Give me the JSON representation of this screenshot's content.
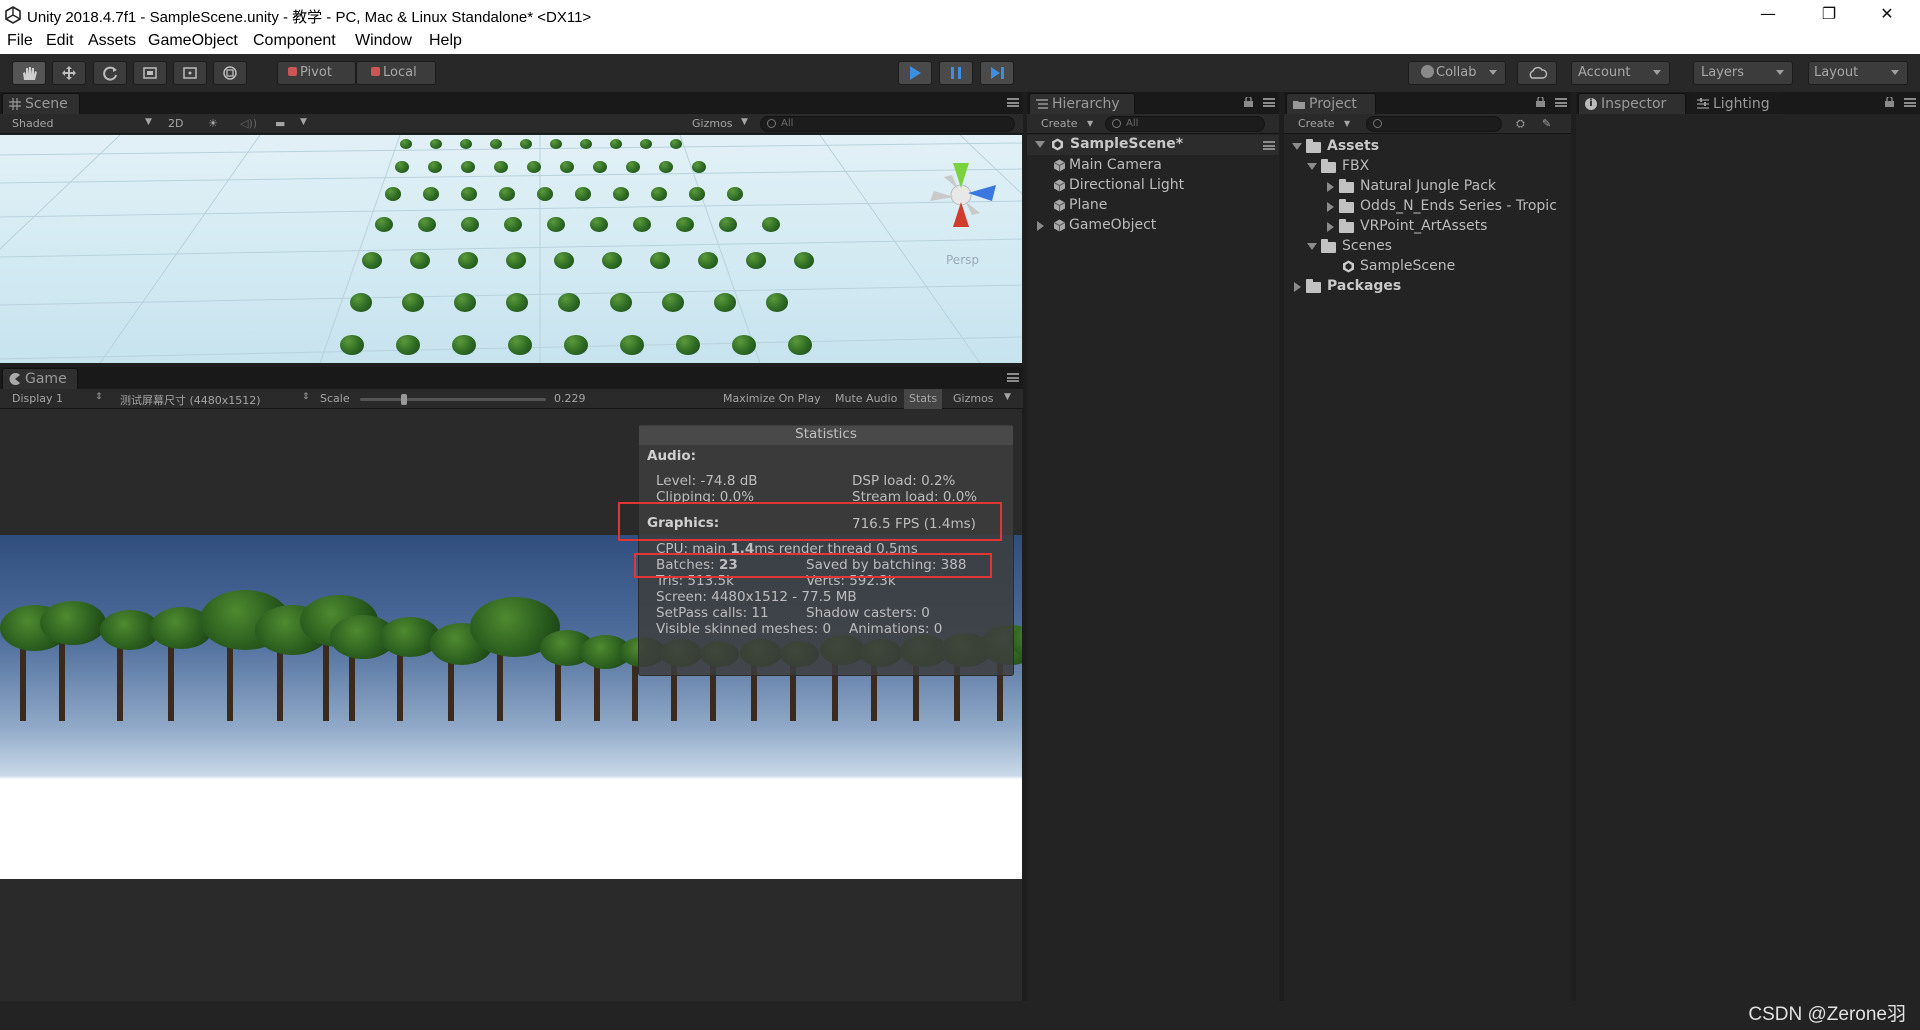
{
  "window": {
    "title": "Unity 2018.4.7f1 - SampleScene.unity - 教学 - PC, Mac & Linux Standalone* <DX11>",
    "controls": [
      "—",
      "❐",
      "✕"
    ]
  },
  "menu": [
    "File",
    "Edit",
    "Assets",
    "GameObject",
    "Component",
    "Window",
    "Help"
  ],
  "toolbar": {
    "pivot": "Pivot",
    "local": "Local",
    "collab": "Collab",
    "account": "Account",
    "layers": "Layers",
    "layout": "Layout"
  },
  "scene": {
    "tab": "Scene",
    "shading": "Shaded",
    "mode_2d": "2D",
    "gizmos": "Gizmos",
    "search_placeholder": "All",
    "persp_label": "Persp"
  },
  "game": {
    "tab": "Game",
    "display": "Display 1",
    "resolution": "测试屏幕尺寸 (4480x1512)",
    "scale_label": "Scale",
    "scale_value": "0.229",
    "scale_fraction": 0.229,
    "maximize": "Maximize On Play",
    "mute": "Mute Audio",
    "stats": "Stats",
    "gizmos": "Gizmos"
  },
  "statistics": {
    "title": "Statistics",
    "audio_header": "Audio:",
    "level": "Level: -74.8 dB",
    "dsp": "DSP load: 0.2%",
    "clipping": "Clipping: 0.0%",
    "stream": "Stream load: 0.0%",
    "graphics_header": "Graphics:",
    "fps": "716.5 FPS (1.4ms)",
    "cpu_main": "CPU: main ",
    "cpu_main_value": "1.4",
    "cpu_rest": "ms  render thread 0.5ms",
    "batches_label": "Batches: ",
    "batches_value": "23",
    "saved": "Saved by batching: 388",
    "tris": "Tris: 513.5k",
    "verts": "Verts: 592.3k",
    "screen": "Screen: 4480x1512 - 77.5 MB",
    "setpass": "SetPass calls: 11",
    "shadow": "Shadow casters: 0",
    "skinned": "Visible skinned meshes: 0",
    "animations": "Animations: 0"
  },
  "hierarchy": {
    "tab": "Hierarchy",
    "create": "Create",
    "search_placeholder": "All",
    "scene": "SampleScene*",
    "items": [
      "Main Camera",
      "Directional Light",
      "Plane",
      "GameObject"
    ]
  },
  "project": {
    "tab": "Project",
    "create": "Create",
    "assets": "Assets",
    "fbx": "FBX",
    "fbx_children": [
      "Natural Jungle Pack",
      "Odds_N_Ends Series - Tropic",
      "VRPoint_ArtAssets"
    ],
    "scenes": "Scenes",
    "sample_scene": "SampleScene",
    "packages": "Packages"
  },
  "inspector": {
    "tab": "Inspector",
    "lighting_tab": "Lighting"
  },
  "watermark": "CSDN @Zerone羽",
  "colors": {
    "highlight_box": "#e23535",
    "play_blue": "#3c8fe0",
    "editor_bg": "#232323"
  }
}
